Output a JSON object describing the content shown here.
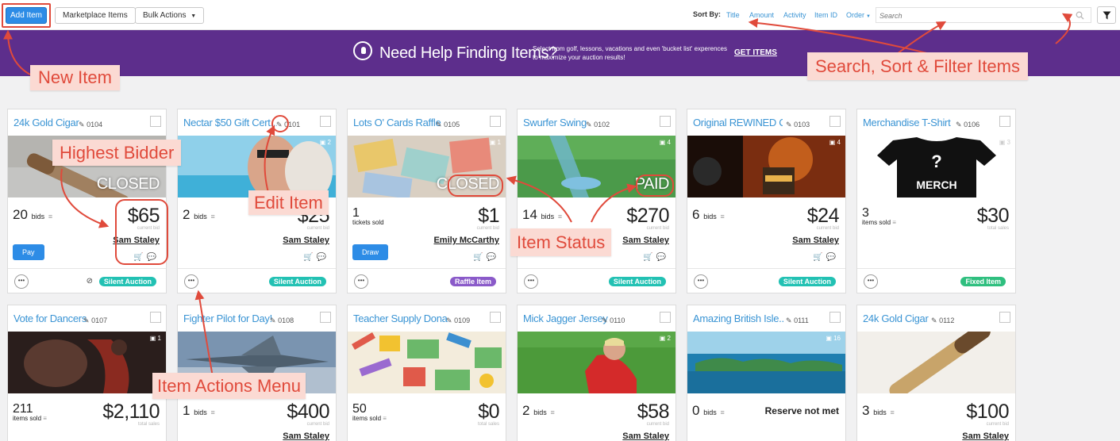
{
  "toolbar": {
    "add_item": "Add Item",
    "marketplace": "Marketplace Items",
    "bulk_actions": "Bulk Actions",
    "sort_by": "Sort By:",
    "sort_title": "Title",
    "sort_amount": "Amount",
    "sort_activity": "Activity",
    "sort_item_id": "Item ID",
    "sort_order": "Order",
    "search_placeholder": "Search"
  },
  "banner": {
    "headline": "Need Help Finding Items?",
    "subtext": "Select from golf, lessons, vacations and even 'bucket list' experences to maximize your auction results!",
    "cta": "GET ITEMS"
  },
  "cards": [
    {
      "title": "24k Gold Cigar",
      "id": "0104",
      "img_count": "",
      "status": "CLOSED",
      "count": "20",
      "count_unit": "bids",
      "amount": "$65",
      "amount_label": "current bid",
      "bidder": "Sam Staley",
      "action": "Pay",
      "type": "Silent Auction"
    },
    {
      "title": "Nectar $50 Gift Cert...",
      "id": "0101",
      "img_count": "2",
      "status": "",
      "count": "2",
      "count_unit": "bids",
      "amount": "$25",
      "amount_label": "current bid",
      "bidder": "Sam Staley",
      "action": "",
      "type": "Silent Auction"
    },
    {
      "title": "Lots O' Cards Raffle",
      "id": "0105",
      "img_count": "1",
      "status": "CLOSED",
      "count": "1",
      "count_unit": "tickets sold",
      "amount": "$1",
      "amount_label": "current bid",
      "bidder": "Emily McCarthy",
      "action": "Draw",
      "type": "Raffle Item"
    },
    {
      "title": "Swurfer Swing",
      "id": "0102",
      "img_count": "4",
      "status": "PAID",
      "count": "14",
      "count_unit": "bids",
      "amount": "$270",
      "amount_label": "current bid",
      "bidder": "Sam Staley",
      "action": "",
      "type": "Silent Auction"
    },
    {
      "title": "Original REWINED C...",
      "id": "0103",
      "img_count": "4",
      "status": "",
      "count": "6",
      "count_unit": "bids",
      "amount": "$24",
      "amount_label": "current bid",
      "bidder": "Sam Staley",
      "action": "",
      "type": "Silent Auction"
    },
    {
      "title": "Merchandise T-Shirt",
      "id": "0106",
      "img_count": "3",
      "status": "",
      "count": "3",
      "count_unit": "items sold",
      "amount": "$30",
      "amount_label": "total sales",
      "bidder": "",
      "action": "",
      "type": "Fixed Item"
    },
    {
      "title": "Vote for Dancers",
      "id": "0107",
      "img_count": "1",
      "status": "",
      "count": "211",
      "count_unit": "items sold",
      "amount": "$2,110",
      "amount_label": "total sales",
      "bidder": ""
    },
    {
      "title": "Fighter Pilot for Day!",
      "id": "0108",
      "img_count": "",
      "status": "",
      "count": "1",
      "count_unit": "bids",
      "amount": "$400",
      "amount_label": "current bid",
      "bidder": "Sam Staley"
    },
    {
      "title": "Teacher Supply Dona...",
      "id": "0109",
      "img_count": "",
      "status": "",
      "count": "50",
      "count_unit": "items sold",
      "amount": "$0",
      "amount_label": "total sales",
      "bidder": ""
    },
    {
      "title": "Mick Jagger Jersey",
      "id": "0110",
      "img_count": "2",
      "status": "",
      "count": "2",
      "count_unit": "bids",
      "amount": "$58",
      "amount_label": "current bid",
      "bidder": "Sam Staley"
    },
    {
      "title": "Amazing British Isle...",
      "id": "0111",
      "img_count": "16",
      "status": "",
      "count": "0",
      "count_unit": "bids",
      "amount": "",
      "amount_label": "",
      "bidder": "",
      "reserve": "Reserve not met"
    },
    {
      "title": "24k Gold Cigar",
      "id": "0112",
      "img_count": "",
      "status": "",
      "count": "3",
      "count_unit": "bids",
      "amount": "$100",
      "amount_label": "current bid",
      "bidder": "Sam Staley"
    }
  ],
  "annotations": {
    "new_item": "New Item",
    "search_sort": "Search, Sort & Filter Items",
    "highest_bidder": "Highest Bidder",
    "edit_item": "Edit Item",
    "item_status": "Item Status",
    "item_actions": "Item Actions Menu"
  },
  "colors": {
    "accent_blue": "#2d8ce6",
    "banner_purple": "#5d2e8c",
    "silent_auction": "#22c1b3",
    "raffle_item": "#8a5ac9",
    "fixed_item": "#2fbf7f",
    "annotation_red": "#e04a3b",
    "annotation_bg": "#fbdad3"
  }
}
